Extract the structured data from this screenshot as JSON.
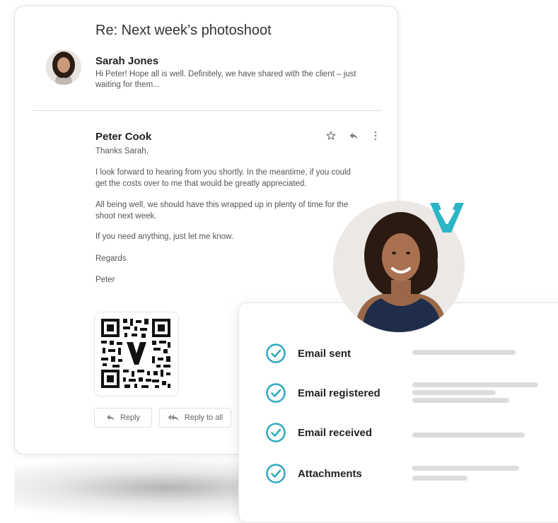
{
  "email": {
    "subject": "Re: Next week’s photoshoot",
    "thread_preview": {
      "sender": "Sarah Jones",
      "preview": "Hi Peter! Hope all is well. Definitely, we have shared with the client – just waiting for them..."
    },
    "message": {
      "sender": "Peter Cook",
      "lines": [
        "Thanks Sarah,",
        "I look forward to hearing from you shortly. In the meantime, if you could get the costs over to me that would be greatly appreciated.",
        "All being well, we should have this wrapped up in plenty of time for the shoot next week.",
        "If you need anything, just let me know.",
        "Regards",
        "Peter"
      ]
    },
    "actions": {
      "star_icon": "star-icon",
      "reply_icon": "reply-icon",
      "more_icon": "more-vertical-icon",
      "reply_label": "Reply",
      "reply_all_label": "Reply to all"
    }
  },
  "status_panel": {
    "items": [
      {
        "label": "Email sent"
      },
      {
        "label": "Email registered"
      },
      {
        "label": "Email received"
      },
      {
        "label": "Attachments"
      }
    ]
  },
  "colors": {
    "accent": "#2bb5c6",
    "check_ring": "#2fa9c0"
  }
}
